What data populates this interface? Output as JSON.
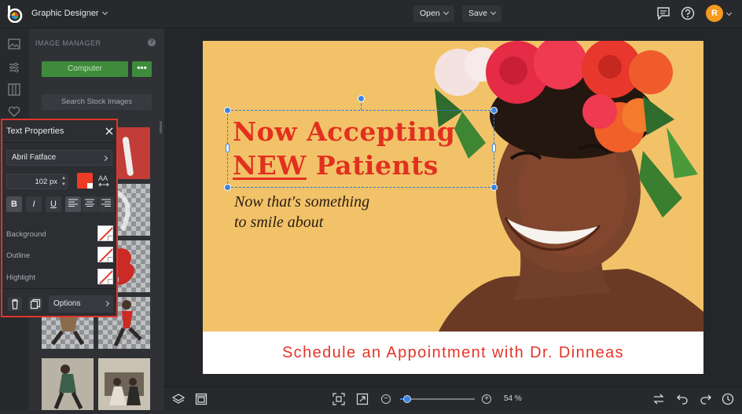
{
  "topbar": {
    "app_title": "Graphic Designer",
    "open_label": "Open",
    "save_label": "Save",
    "avatar_initial": "R"
  },
  "image_manager": {
    "heading": "IMAGE MANAGER",
    "help": "?",
    "computer_label": "Computer",
    "more_label": "•••",
    "stock_label": "Search Stock Images"
  },
  "canvas": {
    "headline_line1": "Now Accepting",
    "headline_new": "NEW",
    "headline_line2_rest": " Patients",
    "sub_line1": "Now that's something",
    "sub_line2": "to smile about",
    "band_text": "Schedule an Appointment with Dr. Dinneas",
    "colors": {
      "background": "#f3c46a",
      "headline": "#e2301f",
      "band_text": "#e3352a"
    }
  },
  "text_properties": {
    "title": "Text Properties",
    "font": "Abril Fatface",
    "size": "102 px",
    "color": "#ee3b26",
    "aa_label": "AA",
    "bold": "B",
    "italic": "I",
    "underline": "U",
    "background_label": "Background",
    "outline_label": "Outline",
    "highlight_label": "Highlight",
    "options_label": "Options"
  },
  "bottombar": {
    "zoom_value": "54 %",
    "zoom_fraction": 0.54,
    "zoom_out": "−",
    "zoom_in": "+"
  },
  "icons": [
    "logo",
    "chevron-down-icon",
    "chat-icon",
    "help-icon",
    "layers-icon",
    "frame-icon",
    "fit-icon",
    "expand-icon",
    "swap-icon",
    "undo-icon",
    "redo-icon",
    "history-icon",
    "close-icon",
    "trash-icon",
    "duplicate-icon"
  ]
}
